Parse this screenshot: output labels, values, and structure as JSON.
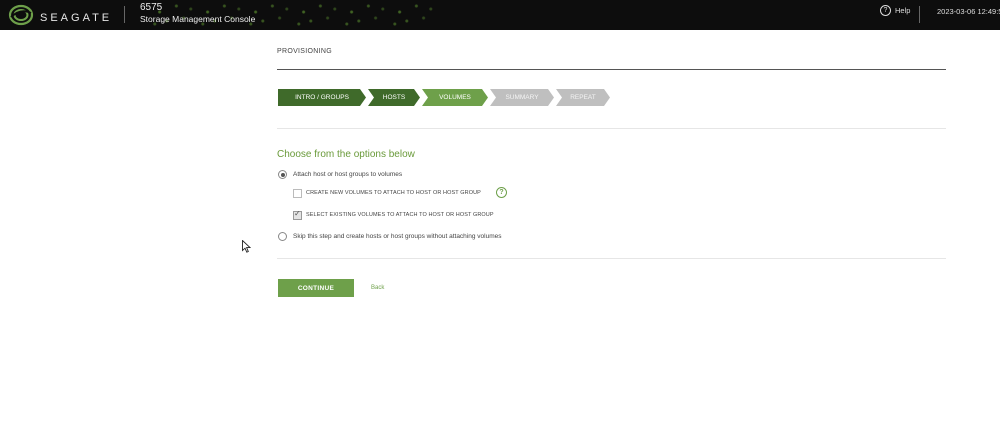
{
  "header": {
    "brand": "SEAGATE",
    "product_id": "6575",
    "product_name": "Storage Management Console",
    "help_label": "Help",
    "datetime": "2023-03-06 12:49:5"
  },
  "page": {
    "title": "PROVISIONING"
  },
  "steps": [
    {
      "label": "INTRO / GROUPS",
      "state": "done"
    },
    {
      "label": "HOSTS",
      "state": "done"
    },
    {
      "label": "VOLUMES",
      "state": "active"
    },
    {
      "label": "SUMMARY",
      "state": "todo"
    },
    {
      "label": "REPEAT",
      "state": "todo"
    }
  ],
  "options": {
    "heading": "Choose from the options below",
    "attach_label": "Attach host or host groups to volumes",
    "attach_selected": true,
    "create_new_label": "CREATE NEW VOLUMES TO ATTACH TO HOST OR HOST GROUP",
    "create_new_checked": false,
    "help_glyph": "?",
    "select_existing_label": "SELECT EXISTING VOLUMES TO ATTACH TO HOST OR HOST GROUP",
    "select_existing_checked": true,
    "skip_label": "Skip this step and create hosts or host groups without attaching volumes",
    "skip_selected": false
  },
  "actions": {
    "continue_label": "CONTINUE",
    "back_label": "Back"
  },
  "colors": {
    "accent": "#6ea04a",
    "step_done": "#3f6a2a",
    "step_todo": "#bfbfbf",
    "topbar": "#0d0d0d"
  },
  "icons": {
    "logo": "seagate-logo-icon",
    "help": "help-circle-icon",
    "tooltip": "question-circle-icon",
    "cursor": "mouse-pointer-icon"
  }
}
